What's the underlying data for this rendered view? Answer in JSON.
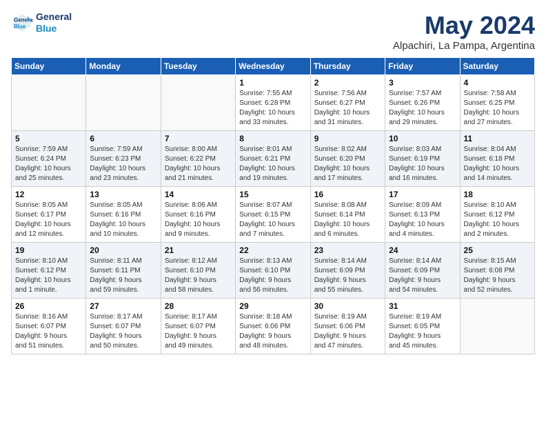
{
  "logo": {
    "line1": "General",
    "line2": "Blue"
  },
  "title": "May 2024",
  "subtitle": "Alpachiri, La Pampa, Argentina",
  "weekdays": [
    "Sunday",
    "Monday",
    "Tuesday",
    "Wednesday",
    "Thursday",
    "Friday",
    "Saturday"
  ],
  "weeks": [
    [
      {
        "day": "",
        "info": ""
      },
      {
        "day": "",
        "info": ""
      },
      {
        "day": "",
        "info": ""
      },
      {
        "day": "1",
        "info": "Sunrise: 7:55 AM\nSunset: 6:28 PM\nDaylight: 10 hours\nand 33 minutes."
      },
      {
        "day": "2",
        "info": "Sunrise: 7:56 AM\nSunset: 6:27 PM\nDaylight: 10 hours\nand 31 minutes."
      },
      {
        "day": "3",
        "info": "Sunrise: 7:57 AM\nSunset: 6:26 PM\nDaylight: 10 hours\nand 29 minutes."
      },
      {
        "day": "4",
        "info": "Sunrise: 7:58 AM\nSunset: 6:25 PM\nDaylight: 10 hours\nand 27 minutes."
      }
    ],
    [
      {
        "day": "5",
        "info": "Sunrise: 7:59 AM\nSunset: 6:24 PM\nDaylight: 10 hours\nand 25 minutes."
      },
      {
        "day": "6",
        "info": "Sunrise: 7:59 AM\nSunset: 6:23 PM\nDaylight: 10 hours\nand 23 minutes."
      },
      {
        "day": "7",
        "info": "Sunrise: 8:00 AM\nSunset: 6:22 PM\nDaylight: 10 hours\nand 21 minutes."
      },
      {
        "day": "8",
        "info": "Sunrise: 8:01 AM\nSunset: 6:21 PM\nDaylight: 10 hours\nand 19 minutes."
      },
      {
        "day": "9",
        "info": "Sunrise: 8:02 AM\nSunset: 6:20 PM\nDaylight: 10 hours\nand 17 minutes."
      },
      {
        "day": "10",
        "info": "Sunrise: 8:03 AM\nSunset: 6:19 PM\nDaylight: 10 hours\nand 16 minutes."
      },
      {
        "day": "11",
        "info": "Sunrise: 8:04 AM\nSunset: 6:18 PM\nDaylight: 10 hours\nand 14 minutes."
      }
    ],
    [
      {
        "day": "12",
        "info": "Sunrise: 8:05 AM\nSunset: 6:17 PM\nDaylight: 10 hours\nand 12 minutes."
      },
      {
        "day": "13",
        "info": "Sunrise: 8:05 AM\nSunset: 6:16 PM\nDaylight: 10 hours\nand 10 minutes."
      },
      {
        "day": "14",
        "info": "Sunrise: 8:06 AM\nSunset: 6:16 PM\nDaylight: 10 hours\nand 9 minutes."
      },
      {
        "day": "15",
        "info": "Sunrise: 8:07 AM\nSunset: 6:15 PM\nDaylight: 10 hours\nand 7 minutes."
      },
      {
        "day": "16",
        "info": "Sunrise: 8:08 AM\nSunset: 6:14 PM\nDaylight: 10 hours\nand 6 minutes."
      },
      {
        "day": "17",
        "info": "Sunrise: 8:09 AM\nSunset: 6:13 PM\nDaylight: 10 hours\nand 4 minutes."
      },
      {
        "day": "18",
        "info": "Sunrise: 8:10 AM\nSunset: 6:12 PM\nDaylight: 10 hours\nand 2 minutes."
      }
    ],
    [
      {
        "day": "19",
        "info": "Sunrise: 8:10 AM\nSunset: 6:12 PM\nDaylight: 10 hours\nand 1 minute."
      },
      {
        "day": "20",
        "info": "Sunrise: 8:11 AM\nSunset: 6:11 PM\nDaylight: 9 hours\nand 59 minutes."
      },
      {
        "day": "21",
        "info": "Sunrise: 8:12 AM\nSunset: 6:10 PM\nDaylight: 9 hours\nand 58 minutes."
      },
      {
        "day": "22",
        "info": "Sunrise: 8:13 AM\nSunset: 6:10 PM\nDaylight: 9 hours\nand 56 minutes."
      },
      {
        "day": "23",
        "info": "Sunrise: 8:14 AM\nSunset: 6:09 PM\nDaylight: 9 hours\nand 55 minutes."
      },
      {
        "day": "24",
        "info": "Sunrise: 8:14 AM\nSunset: 6:09 PM\nDaylight: 9 hours\nand 54 minutes."
      },
      {
        "day": "25",
        "info": "Sunrise: 8:15 AM\nSunset: 6:08 PM\nDaylight: 9 hours\nand 52 minutes."
      }
    ],
    [
      {
        "day": "26",
        "info": "Sunrise: 8:16 AM\nSunset: 6:07 PM\nDaylight: 9 hours\nand 51 minutes."
      },
      {
        "day": "27",
        "info": "Sunrise: 8:17 AM\nSunset: 6:07 PM\nDaylight: 9 hours\nand 50 minutes."
      },
      {
        "day": "28",
        "info": "Sunrise: 8:17 AM\nSunset: 6:07 PM\nDaylight: 9 hours\nand 49 minutes."
      },
      {
        "day": "29",
        "info": "Sunrise: 8:18 AM\nSunset: 6:06 PM\nDaylight: 9 hours\nand 48 minutes."
      },
      {
        "day": "30",
        "info": "Sunrise: 8:19 AM\nSunset: 6:06 PM\nDaylight: 9 hours\nand 47 minutes."
      },
      {
        "day": "31",
        "info": "Sunrise: 8:19 AM\nSunset: 6:05 PM\nDaylight: 9 hours\nand 45 minutes."
      },
      {
        "day": "",
        "info": ""
      }
    ]
  ]
}
